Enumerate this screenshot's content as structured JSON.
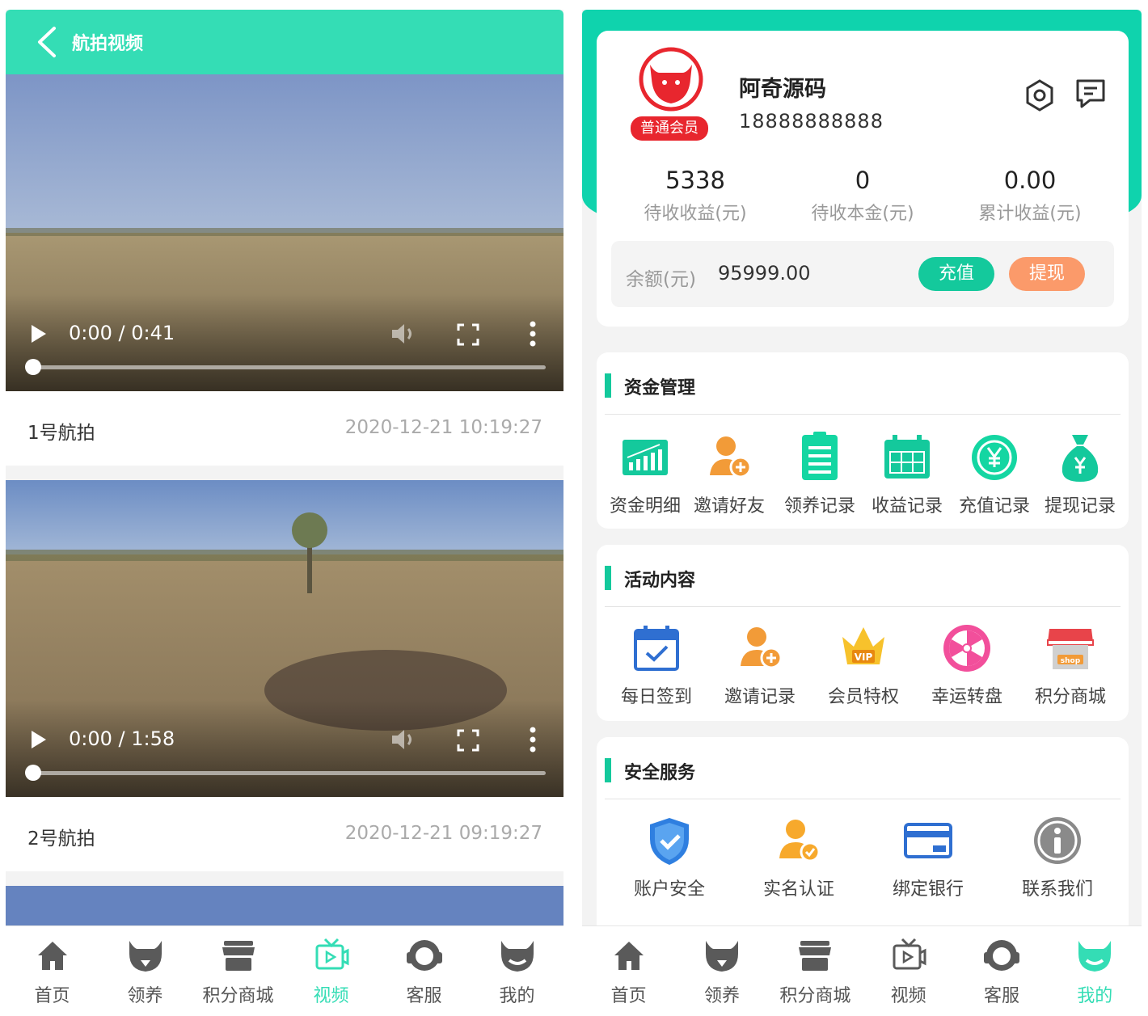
{
  "left": {
    "header_title": "航拍视频",
    "videos": [
      {
        "name": "1号航拍",
        "date": "2020-12-21 10:19:27",
        "time": "0:00 / 0:41"
      },
      {
        "name": "2号航拍",
        "date": "2020-12-21 09:19:27",
        "time": "0:00 / 1:58"
      }
    ],
    "tabbar": [
      {
        "label": "首页",
        "icon": "home-icon"
      },
      {
        "label": "领养",
        "icon": "cow-icon"
      },
      {
        "label": "积分商城",
        "icon": "shop-icon"
      },
      {
        "label": "视频",
        "icon": "video-icon",
        "active": true
      },
      {
        "label": "客服",
        "icon": "headset-icon"
      },
      {
        "label": "我的",
        "icon": "profile-cow-icon"
      }
    ]
  },
  "right": {
    "user": {
      "name": "阿奇源码",
      "phone": "18888888888",
      "member_level": "普通会员"
    },
    "stats": [
      {
        "value": "5338",
        "label": "待收收益(元)"
      },
      {
        "value": "0",
        "label": "待收本金(元)"
      },
      {
        "value": "0.00",
        "label": "累计收益(元)"
      }
    ],
    "balance": {
      "label": "余额(元)",
      "value": "95999.00",
      "recharge_label": "充值",
      "withdraw_label": "提现"
    },
    "sections": [
      {
        "title": "资金管理",
        "items": [
          {
            "label": "资金明细",
            "icon": "chart-icon"
          },
          {
            "label": "邀请好友",
            "icon": "add-user-icon"
          },
          {
            "label": "领养记录",
            "icon": "list-icon"
          },
          {
            "label": "收益记录",
            "icon": "calendar-grid-icon"
          },
          {
            "label": "充值记录",
            "icon": "yen-circle-icon"
          },
          {
            "label": "提现记录",
            "icon": "money-bag-icon"
          }
        ]
      },
      {
        "title": "活动内容",
        "items": [
          {
            "label": "每日签到",
            "icon": "calendar-check-icon"
          },
          {
            "label": "邀请记录",
            "icon": "add-user-icon"
          },
          {
            "label": "会员特权",
            "icon": "vip-crown-icon"
          },
          {
            "label": "幸运转盘",
            "icon": "wheel-icon"
          },
          {
            "label": "积分商城",
            "icon": "shop-icon"
          }
        ]
      },
      {
        "title": "安全服务",
        "items": [
          {
            "label": "账户安全",
            "icon": "shield-icon"
          },
          {
            "label": "实名认证",
            "icon": "verified-user-icon"
          },
          {
            "label": "绑定银行",
            "icon": "bank-card-icon"
          },
          {
            "label": "联系我们",
            "icon": "info-icon"
          }
        ]
      }
    ],
    "tabbar": [
      {
        "label": "首页",
        "icon": "home-icon"
      },
      {
        "label": "领养",
        "icon": "cow-icon"
      },
      {
        "label": "积分商城",
        "icon": "shop-icon"
      },
      {
        "label": "视频",
        "icon": "video-icon"
      },
      {
        "label": "客服",
        "icon": "headset-icon"
      },
      {
        "label": "我的",
        "icon": "profile-cow-icon",
        "active": true
      }
    ]
  },
  "colors": {
    "accent": "#34ddb5",
    "accent_dark": "#14c99c",
    "withdraw": "#fb9a6a",
    "member_badge": "#e8262e"
  }
}
